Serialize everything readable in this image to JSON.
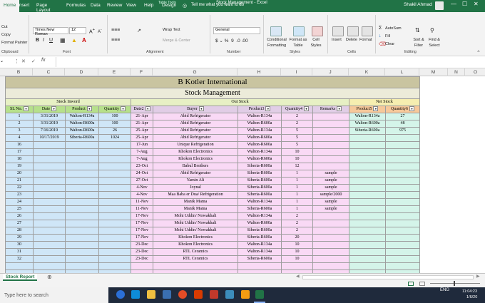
{
  "window": {
    "title": "Stock Management - Excel",
    "user": "Shakil Ahmad",
    "table_tools": "Table Tools",
    "min": "—",
    "max": "☐",
    "close": "✕"
  },
  "tabs": [
    "Home",
    "Insert",
    "Page Layout",
    "Formulas",
    "Data",
    "Review",
    "View",
    "Help",
    "Design"
  ],
  "tell_me": "Tell me what you want to do",
  "ribbon": {
    "cut": "Cut",
    "copy": "Copy",
    "format_painter": "Format Painter",
    "clipboard": "Clipboard",
    "font_name": "Times New Roman",
    "font_size": "12",
    "font_group": "Font",
    "wrap_text": "Wrap Text",
    "merge_center": "Merge & Center",
    "alignment": "Alignment",
    "number_format": "General",
    "number": "Number",
    "conditional_formatting": "Conditional Formatting",
    "format_as_table": "Format as Table",
    "cell_styles": "Cell Styles",
    "styles": "Styles",
    "insert": "Insert",
    "delete": "Delete",
    "format": "Format",
    "cells": "Cells",
    "autosum": "AutoSum",
    "fill": "Fill",
    "clear": "Clear",
    "sort_filter": "Sort & Filter",
    "find_select": "Find & Select",
    "editing": "Editing"
  },
  "columns": [
    "B",
    "C",
    "D",
    "E",
    "F",
    "G",
    "H",
    "I",
    "J",
    "K",
    "L",
    "M",
    "N",
    "O"
  ],
  "sheet": {
    "company": "B Kotler International",
    "subtitle": "Stock Management",
    "stock_inward": "Stock Inword",
    "out_stock": "Out Stock",
    "net_stock": "Net Stock",
    "headers": [
      "SL No.",
      "Date",
      "Product",
      "Quantity",
      "Date2",
      "Buyer",
      "Product3",
      "Quantity4",
      "Remarks",
      "Product5",
      "Quantity6"
    ],
    "inward": [
      [
        "1",
        "3/31/2019",
        "Walton-R134a",
        "100"
      ],
      [
        "2",
        "3/31/2019",
        "Walton-R600a",
        "100"
      ],
      [
        "3",
        "7/16/2019",
        "Walton-R600a",
        "26"
      ],
      [
        "4",
        "10/17/2019",
        "Siberia-R600a",
        "1024"
      ]
    ],
    "sl_more": [
      "16",
      "17",
      "18",
      "19",
      "20",
      "21",
      "22",
      "23",
      "24",
      "25",
      "26",
      "27",
      "28",
      "29",
      "30",
      "31",
      "32"
    ],
    "outstock": [
      [
        "21-Apr",
        "Abid Refrigerator",
        "Walton-R134a",
        "2",
        ""
      ],
      [
        "21-Apr",
        "Abid Refrigerator",
        "Walton-R600a",
        "2",
        ""
      ],
      [
        "25-Apr",
        "Abid Refrigerator",
        "Walton-R134a",
        "5",
        ""
      ],
      [
        "25-Apr",
        "Abid Refrigerator",
        "Walton-R600a",
        "5",
        ""
      ],
      [
        "17-Jun",
        "Unique Refrigeration",
        "Walton-R600a",
        "5",
        ""
      ],
      [
        "7-Aug",
        "Khokon Electronics",
        "Walton-R134a",
        "10",
        ""
      ],
      [
        "7-Aug",
        "Khokon Electronics",
        "Walton-R600a",
        "10",
        ""
      ],
      [
        "23-Oct",
        "Babul Brothers",
        "Siberia-R600a",
        "12",
        ""
      ],
      [
        "24-Oct",
        "Abid Refrigerator",
        "Siberia-R600a",
        "1",
        "sample"
      ],
      [
        "27-Oct",
        "Yamin Ali",
        "Siberia-R600a",
        "1",
        "sample"
      ],
      [
        "4-Nov",
        "Joynal",
        "Siberia-R600a",
        "1",
        "sample"
      ],
      [
        "4-Nov",
        "Maa Baba er Dua/ Refrigeration",
        "Siberia-R600a",
        "1",
        "sample/2000"
      ],
      [
        "11-Nov",
        "Manik Mama",
        "Walton-R134a",
        "1",
        "sample"
      ],
      [
        "11-Nov",
        "Manik Mama",
        "Siberia-R600a",
        "1",
        "sample"
      ],
      [
        "17-Nov",
        "Mohi Uddin/ Nowakhali",
        "Walton-R134a",
        "2",
        ""
      ],
      [
        "17-Nov",
        "Mohi Uddin/ Nowakhali",
        "Walton-R600a",
        "2",
        ""
      ],
      [
        "17-Nov",
        "Mohi Uddin/ Nowakhali",
        "Siberia-R600a",
        "2",
        ""
      ],
      [
        "17-Nov",
        "Khokon Electronics",
        "Siberia-R600a",
        "20",
        ""
      ],
      [
        "23-Dec",
        "Khokon Electronics",
        "Walton-R134a",
        "10",
        ""
      ],
      [
        "23-Dec",
        "RTL Ceramics",
        "Walton-R134a",
        "10",
        ""
      ],
      [
        "23-Dec",
        "RTL Ceramics",
        "Siberia-R600a",
        "10",
        ""
      ]
    ],
    "net": [
      [
        "Walton-R134a",
        "27"
      ],
      [
        "Walton-R600a",
        "48"
      ],
      [
        "Siberia-R600a",
        "975"
      ]
    ]
  },
  "sheet_tab": "Stock Report",
  "taskbar": {
    "search": "Type here to search",
    "time": "11:04:23",
    "date": "1/6/20",
    "lang": "ENG"
  },
  "colors": {
    "excel_green": "#217346",
    "inward": "#cfe6f7",
    "out": "#f9d9f5",
    "net": "#d4f4e9"
  }
}
